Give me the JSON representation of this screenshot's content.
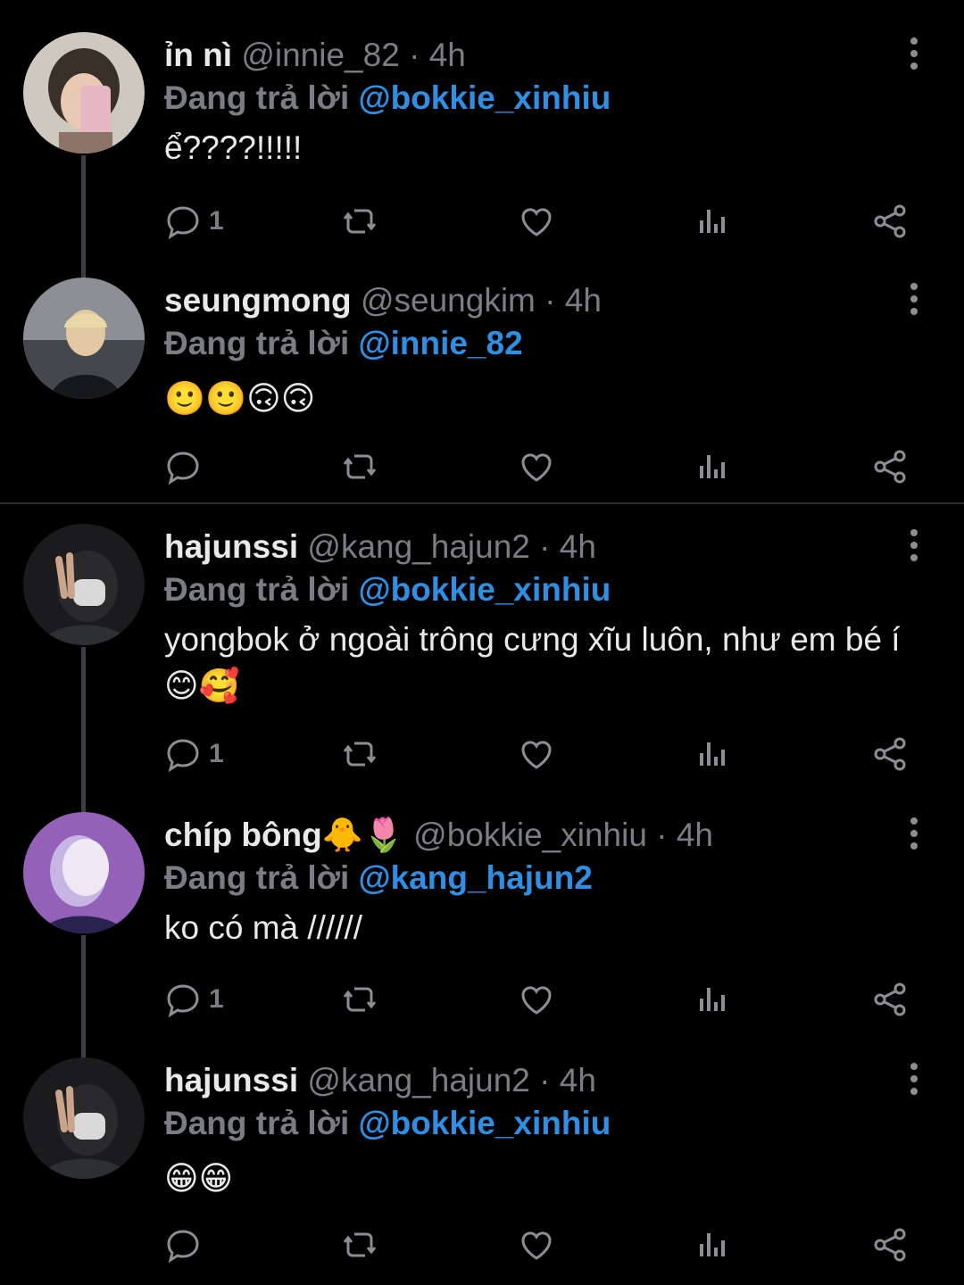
{
  "tweets": [
    {
      "name": "ỉn nì",
      "handle": "@innie_82",
      "time": "4h",
      "replying_label": "Đang trả lời",
      "mention": "@bokkie_xinhiu",
      "text": "ể????!!!!!",
      "reply_count": "1"
    },
    {
      "name": "seungmong",
      "handle": "@seungkim",
      "time": "4h",
      "replying_label": "Đang trả lời",
      "mention": "@innie_82",
      "text": "🙂🙂🙃🙃",
      "reply_count": ""
    },
    {
      "name": "hajunssi",
      "handle": "@kang_hajun2",
      "time": "4h",
      "replying_label": "Đang trả lời",
      "mention": "@bokkie_xinhiu",
      "text": "yongbok ở ngoài trông cưng xĩu luôn, như em bé í😊🥰",
      "reply_count": "1"
    },
    {
      "name": "chíp bông🐥🌷",
      "handle": "@bokkie_xinhiu",
      "time": "4h",
      "replying_label": "Đang trả lời",
      "mention": "@kang_hajun2",
      "text": "ko có mà //////",
      "reply_count": "1"
    },
    {
      "name": "hajunssi",
      "handle": "@kang_hajun2",
      "time": "4h",
      "replying_label": "Đang trả lời",
      "mention": "@bokkie_xinhiu",
      "text": "😁😁",
      "reply_count": ""
    }
  ],
  "separator": "·",
  "icons": [
    "more-vertical-icon",
    "reply-icon",
    "retweet-icon",
    "like-icon",
    "analytics-icon",
    "share-icon"
  ],
  "colors": {
    "background": "#000000",
    "mention": "#2f90e3",
    "muted": "#7a7d82",
    "thread_line": "#3a3d41"
  }
}
